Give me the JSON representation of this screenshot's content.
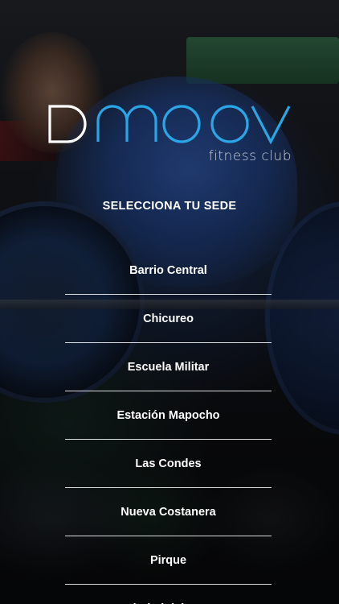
{
  "brand": {
    "logo_text": "DMOOV",
    "tagline": "fitness club",
    "accent_color": "#2aa6e6",
    "d_color": "#ffffff"
  },
  "heading": "SELECCIONA TU SEDE",
  "sedes": [
    {
      "label": "Barrio Central"
    },
    {
      "label": "Chicureo"
    },
    {
      "label": "Escuela Militar"
    },
    {
      "label": "Estación Mapocho"
    },
    {
      "label": "Las Condes"
    },
    {
      "label": "Nueva Costanera"
    },
    {
      "label": "Pirque"
    },
    {
      "label": "Ciudad del Este"
    }
  ]
}
